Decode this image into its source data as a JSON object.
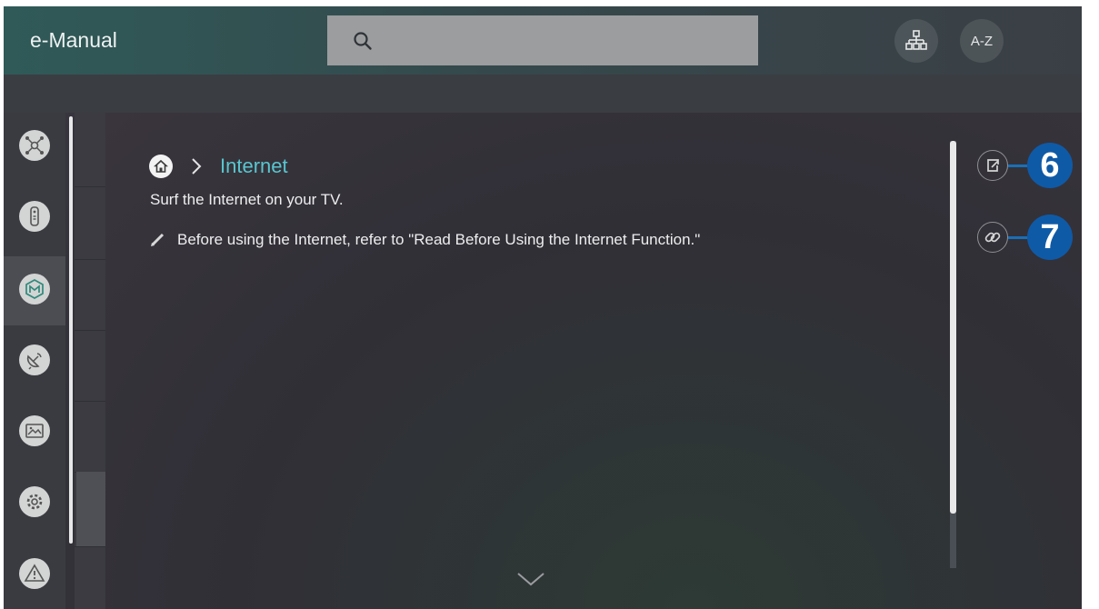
{
  "header": {
    "title": "e-Manual",
    "index_label": "A-Z"
  },
  "breadcrumb": {
    "current": "Internet"
  },
  "content": {
    "description": "Surf the Internet on your TV.",
    "note": "Before using the Internet, refer to \"Read Before Using the Internet Function.\""
  },
  "callouts": [
    "6",
    "7"
  ],
  "icons": {
    "search": "search-icon",
    "sitemap": "sitemap-icon",
    "home": "home-icon",
    "pencil": "pencil-icon",
    "open_link": "open-link-icon",
    "link": "link-icon",
    "scroll_down": "chevron-down-icon"
  },
  "sidebar": {
    "items": [
      "hub-icon",
      "remote-icon",
      "internet-icon",
      "satellite-icon",
      "picture-icon",
      "settings-icon",
      "warning-icon"
    ],
    "selected_index": 2
  },
  "colors": {
    "accent": "#58c6d0",
    "callout": "#0f5aa6"
  }
}
